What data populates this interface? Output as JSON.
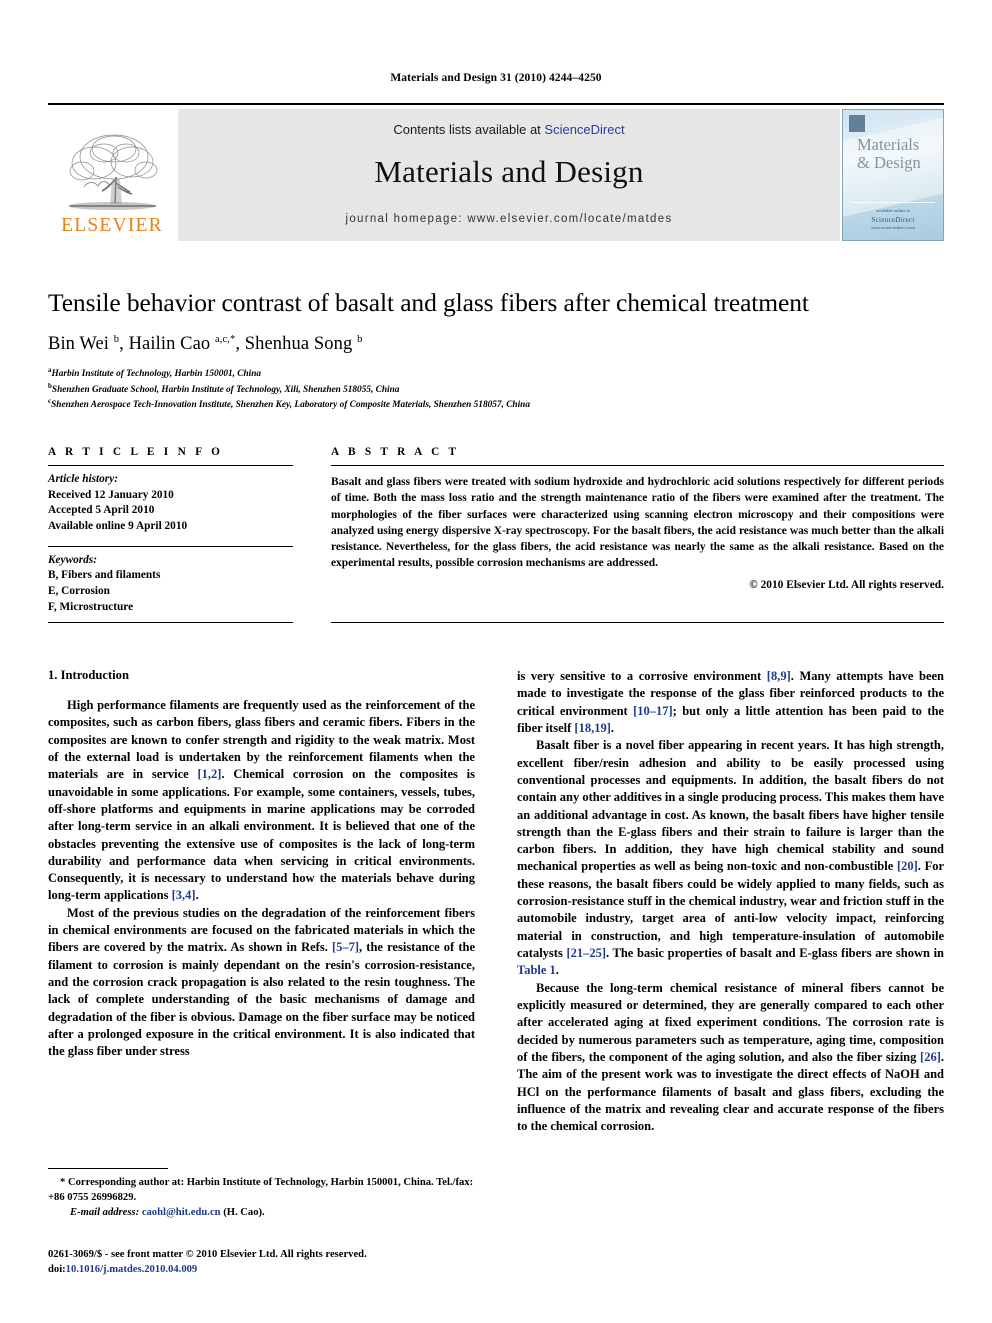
{
  "running_head": "Materials and Design 31 (2010) 4244–4250",
  "masthead": {
    "publisher_name": "ELSEVIER",
    "contents_prefix": "Contents lists available at ",
    "contents_link": "ScienceDirect",
    "journal_title": "Materials and Design",
    "homepage": "journal homepage: www.elsevier.com/locate/matdes",
    "cover": {
      "line1": "Materials",
      "line2": "& Design",
      "foot_small": "available online at",
      "foot_big": "ScienceDirect",
      "foot_url": "www.sciencedirect.com"
    }
  },
  "article": {
    "title": "Tensile behavior contrast of basalt and glass fibers after chemical treatment",
    "authors_html": "Bin Wei <sup>b</sup>, Hailin Cao <sup>a,c,*</sup>, Shenhua Song <sup>b</sup>",
    "affiliations": [
      {
        "marker": "a",
        "text": "Harbin Institute of Technology, Harbin 150001, China"
      },
      {
        "marker": "b",
        "text": "Shenzhen Graduate School, Harbin Institute of Technology, Xili, Shenzhen 518055, China"
      },
      {
        "marker": "c",
        "text": "Shenzhen Aerospace Tech-Innovation Institute, Shenzhen Key, Laboratory of Composite Materials, Shenzhen 518057, China"
      }
    ]
  },
  "article_info": {
    "label": "A R T I C L E    I N F O",
    "history_label": "Article history:",
    "history": [
      "Received 12 January 2010",
      "Accepted 5 April 2010",
      "Available online 9 April 2010"
    ],
    "keywords_label": "Keywords:",
    "keywords": [
      "B, Fibers and filaments",
      "E, Corrosion",
      "F, Microstructure"
    ]
  },
  "abstract": {
    "label": "A B S T R A C T",
    "text": "Basalt and glass fibers were treated with sodium hydroxide and hydrochloric acid solutions respectively for different periods of time. Both the mass loss ratio and the strength maintenance ratio of the fibers were examined after the treatment. The morphologies of the fiber surfaces were characterized using scanning electron microscopy and their compositions were analyzed using energy dispersive X-ray spectroscopy. For the basalt fibers, the acid resistance was much better than the alkali resistance. Nevertheless, for the glass fibers, the acid resistance was nearly the same as the alkali resistance. Based on the experimental results, possible corrosion mechanisms are addressed.",
    "copyright": "© 2010 Elsevier Ltd. All rights reserved."
  },
  "body": {
    "section_heading": "1. Introduction",
    "left_paragraphs": [
      "High performance filaments are frequently used as the reinforcement of the composites, such as carbon fibers, glass fibers and ceramic fibers. Fibers in the composites are known to confer strength and rigidity to the weak matrix. Most of the external load is undertaken by the reinforcement filaments when the materials are in service [1,2]. Chemical corrosion on the composites is unavoidable in some applications. For example, some containers, vessels, tubes, off-shore platforms and equipments in marine applications may be corroded after long-term service in an alkali environment. It is believed that one of the obstacles preventing the extensive use of composites is the lack of long-term durability and performance data when servicing in critical environments. Consequently, it is necessary to understand how the materials behave during long-term applications [3,4].",
      "Most of the previous studies on the degradation of the reinforcement fibers in chemical environments are focused on the fabricated materials in which the fibers are covered by the matrix. As shown in Refs. [5–7], the resistance of the filament to corrosion is mainly dependant on the resin's corrosion-resistance, and the corrosion crack propagation is also related to the resin toughness. The lack of complete understanding of the basic mechanisms of damage and degradation of the fiber is obvious. Damage on the fiber surface may be noticed after a prolonged exposure in the critical environment. It is also indicated that the glass fiber under stress"
    ],
    "right_paragraphs": [
      "is very sensitive to a corrosive environment [8,9]. Many attempts have been made to investigate the response of the glass fiber reinforced products to the critical environment [10–17]; but only a little attention has been paid to the fiber itself [18,19].",
      "Basalt fiber is a novel fiber appearing in recent years. It has high strength, excellent fiber/resin adhesion and ability to be easily processed using conventional processes and equipments. In addition, the basalt fibers do not contain any other additives in a single producing process. This makes them have an additional advantage in cost. As known, the basalt fibers have higher tensile strength than the E-glass fibers and their strain to failure is larger than the carbon fibers. In addition, they have high chemical stability and sound mechanical properties as well as being non-toxic and non-combustible [20]. For these reasons, the basalt fibers could be widely applied to many fields, such as corrosion-resistance stuff in the chemical industry, wear and friction stuff in the automobile industry, target area of anti-low velocity impact, reinforcing material in construction, and high temperature-insulation of automobile catalysts [21–25]. The basic properties of basalt and E-glass fibers are shown in Table 1.",
      "Because the long-term chemical resistance of mineral fibers cannot be explicitly measured or determined, they are generally compared to each other after accelerated aging at fixed experiment conditions. The corrosion rate is decided by numerous parameters such as temperature, aging time, composition of the fibers, the component of the aging solution, and also the fiber sizing [26]. The aim of the present work was to investigate the direct effects of NaOH and HCl on the performance filaments of basalt and glass fibers, excluding the influence of the matrix and revealing clear and accurate response of the fibers to the chemical corrosion."
    ]
  },
  "footnote": {
    "corresponding": "* Corresponding author at: Harbin Institute of Technology, Harbin 150001, China. Tel./fax: +86 0755 26996829.",
    "email_label": "E-mail address:",
    "email": "caohl@hit.edu.cn",
    "email_suffix": "(H. Cao)."
  },
  "imprint": {
    "line1": "0261-3069/$ - see front matter © 2010 Elsevier Ltd. All rights reserved.",
    "doi_label": "doi:",
    "doi": "10.1016/j.matdes.2010.04.009"
  },
  "colors": {
    "link": "#1d3a8f",
    "elsevier_orange": "#F07F12",
    "sciencedirect_blue": "#2a3f9d",
    "masthead_grey": "#e6e6e6"
  }
}
